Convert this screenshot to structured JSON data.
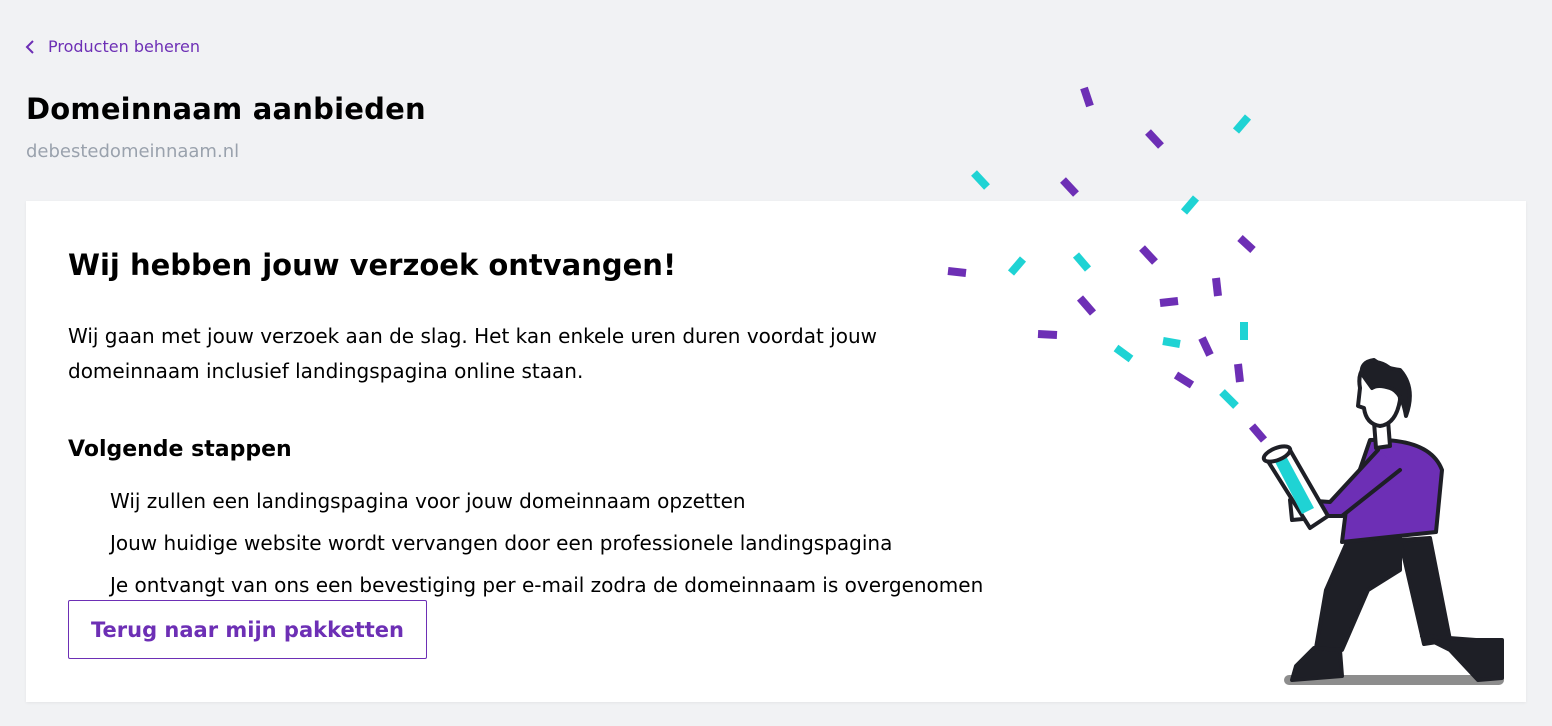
{
  "breadcrumb": {
    "back_label": "Producten beheren",
    "icon": "chevron-left-icon"
  },
  "header": {
    "title": "Domeinnaam aanbieden",
    "domain": "debestedomeinnaam.nl"
  },
  "confirmation": {
    "heading": "Wij hebben jouw verzoek ontvangen!",
    "intro_line1": "Wij gaan met jouw verzoek aan de slag. Het kan enkele uren duren voordat jouw",
    "intro_line2": "domeinnaam inclusief landingspagina online staan.",
    "steps_heading": "Volgende stappen",
    "steps": [
      "Wij zullen een landingspagina voor jouw domeinnaam opzetten",
      "Jouw huidige website wordt vervangen door een professionele landingspagina",
      "Je ontvangt van ons een bevestiging per e-mail zodra de domeinnaam is overgenomen"
    ],
    "button_label": "Terug naar mijn pakketten"
  },
  "illustration": {
    "name": "celebration-confetti-illustration",
    "colors": {
      "purple": "#6d2fb5",
      "cyan": "#1fd3d4",
      "ink": "#1e1f26",
      "shadow": "#8d8d8d"
    }
  },
  "theme": {
    "accent": "#6d2fb5",
    "background": "#f1f2f4",
    "muted_text": "#9aa2ad"
  }
}
